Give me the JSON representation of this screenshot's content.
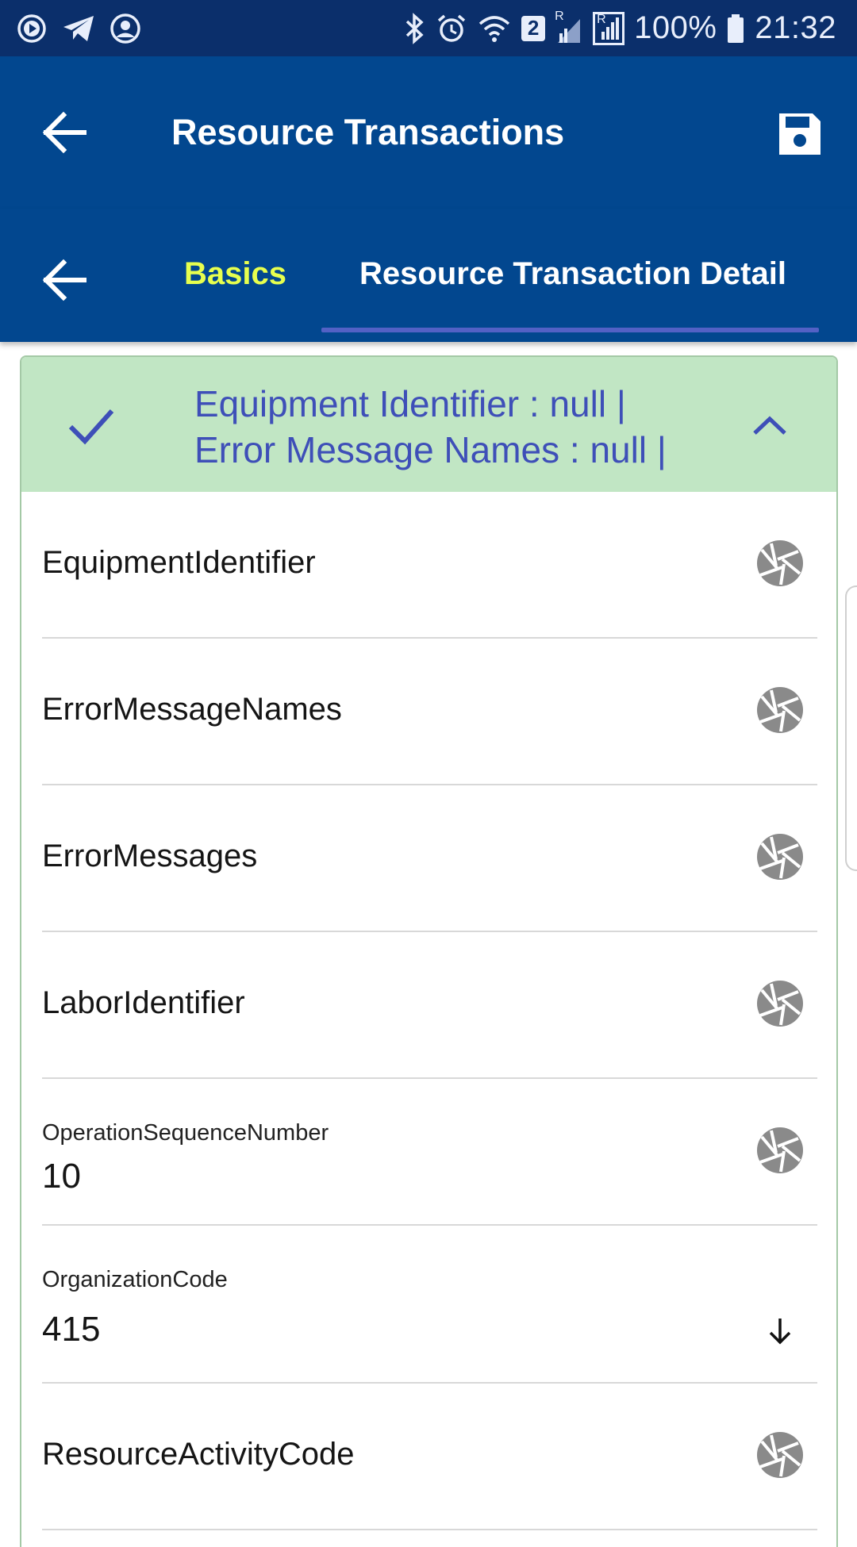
{
  "status_bar": {
    "battery": "100%",
    "time": "21:32",
    "sim_badge": "2",
    "roaming_badge": "R",
    "icons": [
      "media-icon",
      "telegram-icon",
      "account-icon",
      "bluetooth-icon",
      "alarm-icon",
      "wifi-icon",
      "signal-icon",
      "battery-icon"
    ]
  },
  "app_bar": {
    "title": "Resource Transactions",
    "back_icon": "back-arrow-icon",
    "save_icon": "save-icon"
  },
  "tabs": {
    "items": [
      {
        "label": "Basics",
        "active": false,
        "color": "#e7ff4e"
      },
      {
        "label": "Resource Transaction Detail",
        "active": true,
        "color": "#ffffff"
      }
    ],
    "indicator_color": "#5361c5"
  },
  "card": {
    "summary_line1": "Equipment Identifier : null |",
    "summary_line2": "Error Message Names : null |",
    "header_color": "#c1e6c4",
    "summary_color": "#3e4fb8",
    "fields": [
      {
        "label": "EquipmentIdentifier",
        "value": "",
        "icon": "aperture-icon"
      },
      {
        "label": "ErrorMessageNames",
        "value": "",
        "icon": "aperture-icon"
      },
      {
        "label": "ErrorMessages",
        "value": "",
        "icon": "aperture-icon"
      },
      {
        "label": "LaborIdentifier",
        "value": "",
        "icon": "aperture-icon"
      },
      {
        "label": "OperationSequenceNumber",
        "value": "10",
        "icon": "aperture-icon"
      },
      {
        "label": "OrganizationCode",
        "value": "415",
        "icon": "arrow-down-icon"
      },
      {
        "label": "ResourceActivityCode",
        "value": "",
        "icon": "aperture-icon"
      }
    ]
  },
  "colors": {
    "status_bar": "#0b2f6b",
    "app_bar": "#02478f",
    "icon_gray": "#8a8a8a"
  }
}
